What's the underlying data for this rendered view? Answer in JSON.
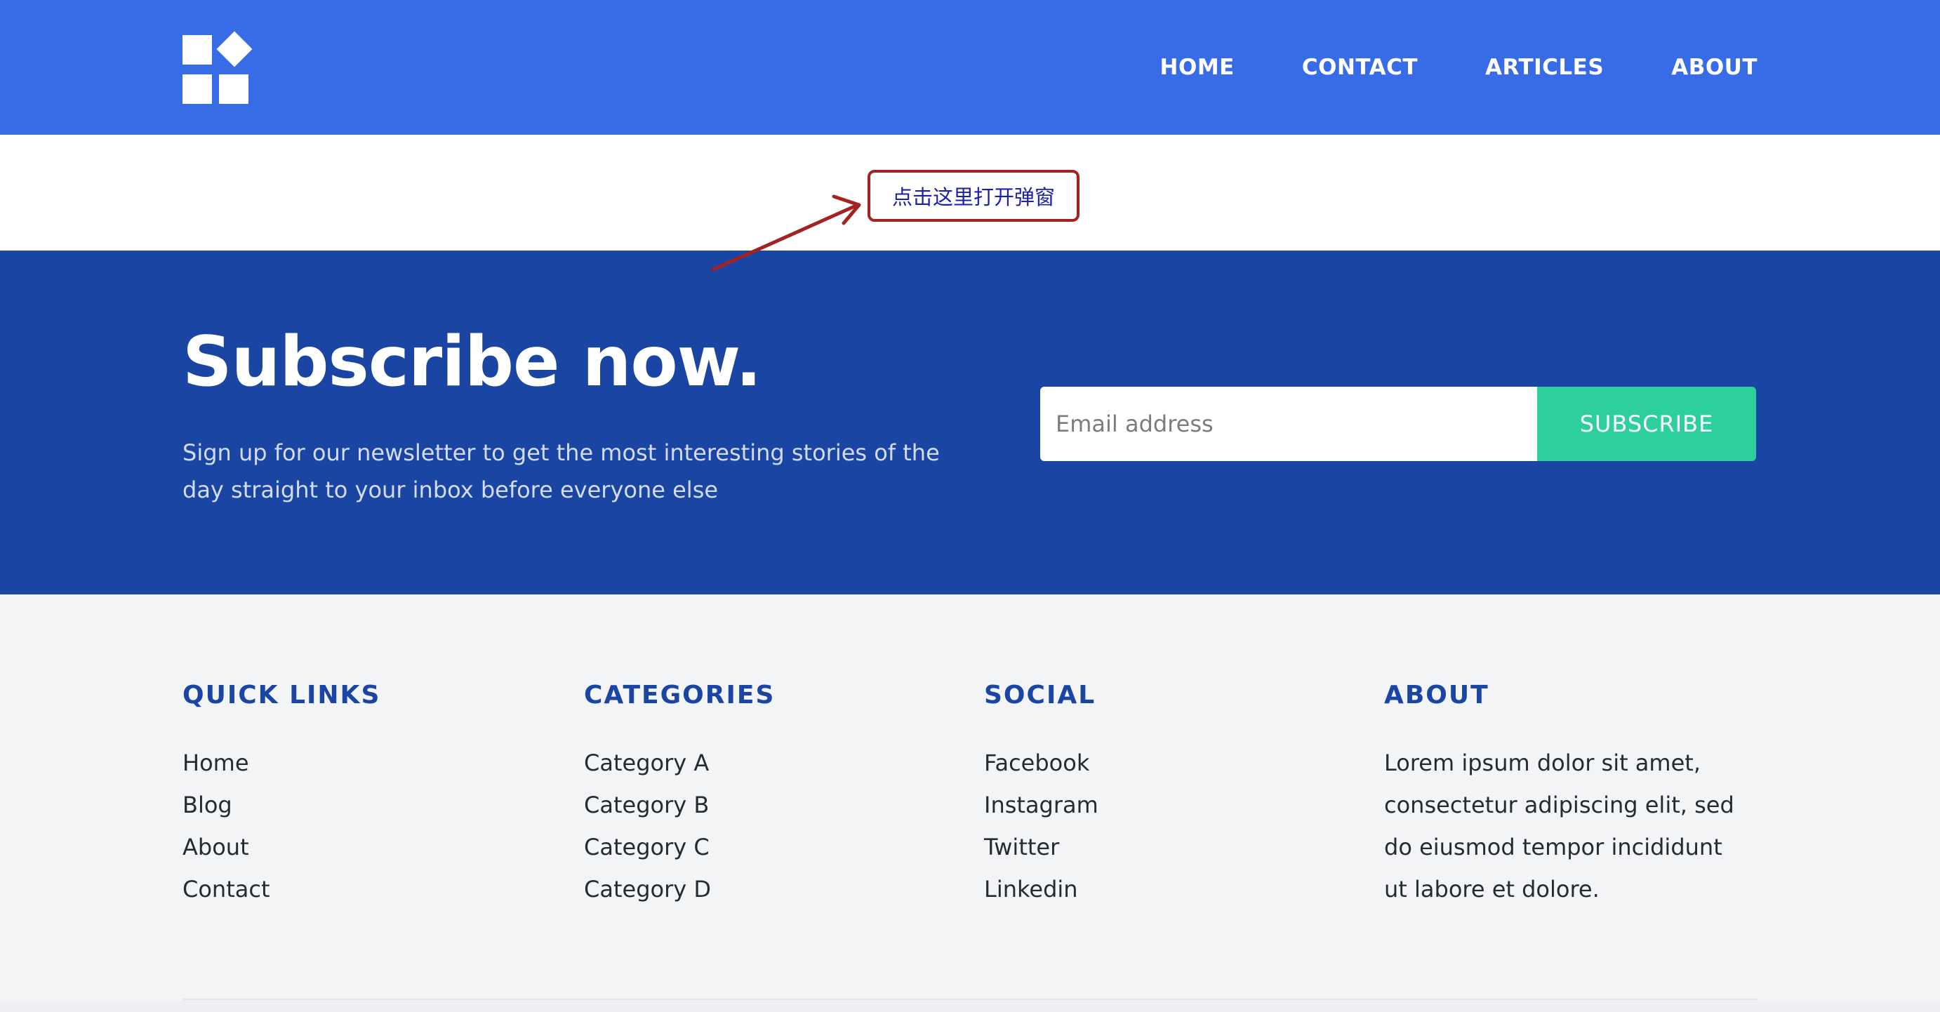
{
  "header": {
    "nav": [
      {
        "label": "HOME"
      },
      {
        "label": "CONTACT"
      },
      {
        "label": "ARTICLES"
      },
      {
        "label": "ABOUT"
      }
    ]
  },
  "annotation": {
    "callout_text": "点击这里打开弹窗",
    "border_color": "#a32323",
    "text_color": "#1c1fa8"
  },
  "subscribe": {
    "title": "Subscribe now.",
    "description": "Sign up for our newsletter to get the most interesting stories of the day straight to your inbox before everyone else",
    "email_placeholder": "Email address",
    "email_value": "",
    "button_label": "SUBSCRIBE"
  },
  "footer": {
    "columns": [
      {
        "title": "QUICK LINKS",
        "items": [
          "Home",
          "Blog",
          "About",
          "Contact"
        ]
      },
      {
        "title": "CATEGORIES",
        "items": [
          "Category A",
          "Category B",
          "Category C",
          "Category D"
        ]
      },
      {
        "title": "SOCIAL",
        "items": [
          "Facebook",
          "Instagram",
          "Twitter",
          "Linkedin"
        ]
      },
      {
        "title": "ABOUT",
        "text": "Lorem ipsum dolor sit amet, consectetur adipiscing elit, sed do eiusmod tempor incididunt ut labore et dolore."
      }
    ]
  },
  "colors": {
    "header_bg": "#386be6",
    "subscribe_bg": "#1a45a3",
    "accent_green": "#2dd09c",
    "footer_bg": "#f3f4f6",
    "footer_heading": "#1a45a3"
  },
  "icons": {
    "logo": "squares-and-diamond-logo-icon"
  }
}
